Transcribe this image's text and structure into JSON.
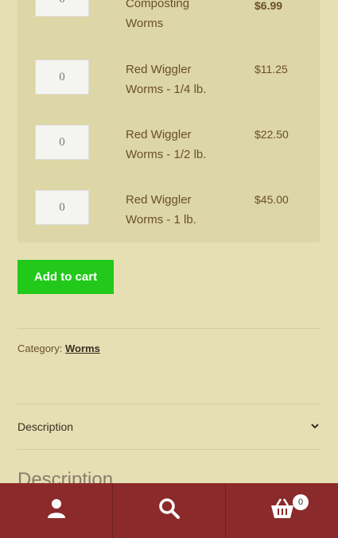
{
  "products": [
    {
      "qty": "0",
      "name": "Composting Worms",
      "price": "$6.99"
    },
    {
      "qty": "0",
      "name": "Red Wiggler Worms - 1/4 lb.",
      "price": "$11.25"
    },
    {
      "qty": "0",
      "name": "Red Wiggler Worms - 1/2 lb.",
      "price": "$22.50"
    },
    {
      "qty": "0",
      "name": "Red Wiggler Worms - 1 lb.",
      "price": "$45.00"
    }
  ],
  "add_to_cart_label": "Add to cart",
  "category": {
    "label": "Category:",
    "value": "Worms"
  },
  "tab": {
    "label": "Description"
  },
  "section_heading": "Description",
  "bottom_bar": {
    "cart_count": "0"
  },
  "colors": {
    "accent": "#22c91a",
    "bar": "#8b2a2a",
    "background": "#e6dfb4"
  },
  "icons": [
    "user-icon",
    "search-icon",
    "basket-icon",
    "chevron-down-icon"
  ]
}
